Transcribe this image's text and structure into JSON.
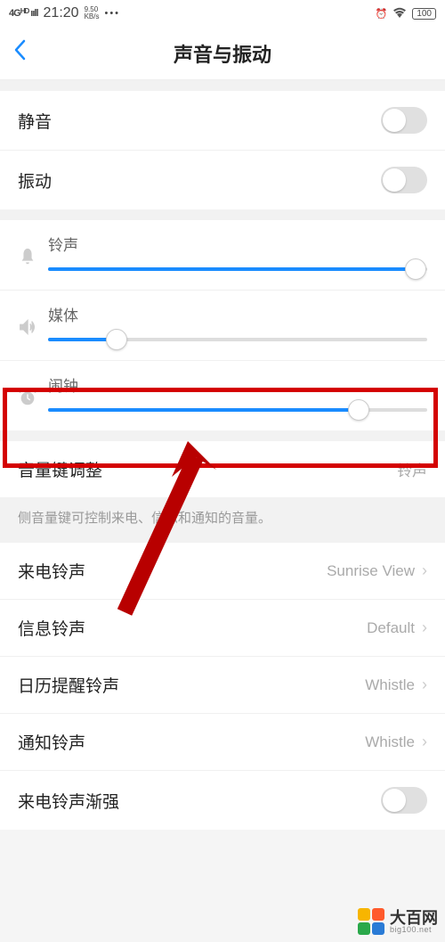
{
  "status": {
    "network": "4G",
    "hd": "HD",
    "time": "21:20",
    "speed1": "9.50",
    "speed2": "KB/s",
    "battery": "100"
  },
  "nav": {
    "title": "声音与振动"
  },
  "toggles": {
    "mute": "静音",
    "vibrate": "振动"
  },
  "sliders": {
    "ring": {
      "label": "铃声",
      "pct": 97
    },
    "media": {
      "label": "媒体",
      "pct": 18
    },
    "alarm": {
      "label": "闹钟",
      "pct": 82
    }
  },
  "volkey": {
    "label": "音量键调整",
    "value": "铃声",
    "desc": "侧音量键可控制来电、信息和通知的音量。"
  },
  "ringtones": {
    "incoming": {
      "label": "来电铃声",
      "value": "Sunrise View"
    },
    "message": {
      "label": "信息铃声",
      "value": "Default"
    },
    "calendar": {
      "label": "日历提醒铃声",
      "value": "Whistle"
    },
    "notify": {
      "label": "通知铃声",
      "value": "Whistle"
    },
    "gradual": {
      "label": "来电铃声渐强"
    }
  },
  "watermark": {
    "main": "大百网",
    "sub": "big100.net"
  }
}
